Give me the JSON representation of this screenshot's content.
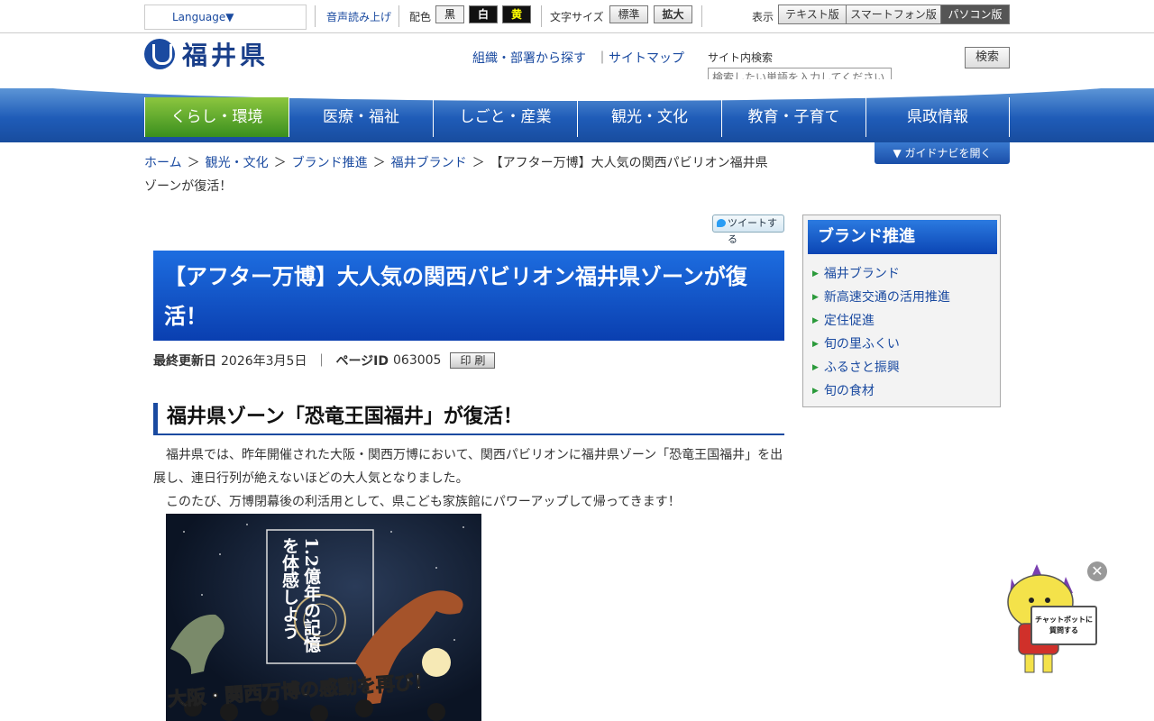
{
  "topbar": {
    "language": "Language▼",
    "read_aloud": "音声読み上げ",
    "color_label": "配色",
    "color_black": "黒",
    "color_white": "白",
    "color_yellow": "黄",
    "font_size_label": "文字サイズ",
    "font_standard": "標準",
    "font_large": "拡大",
    "display_label": "表示",
    "display_text": "テキスト版",
    "display_phone": "スマートフォン版",
    "display_pc": "パソコン版"
  },
  "header": {
    "logo_text": "福井県",
    "org_link": "組織・部署から探す",
    "link_separator": "｜",
    "sitemap_link": "サイトマップ",
    "search_label": "サイト内検索",
    "search_placeholder": "検索したい単語を入力してください",
    "search_button": "検索"
  },
  "nav": {
    "items": [
      {
        "label": "くらし・環境"
      },
      {
        "label": "医療・福祉"
      },
      {
        "label": "しごと・産業"
      },
      {
        "label": "観光・文化"
      },
      {
        "label": "教育・子育て"
      },
      {
        "label": "県政情報"
      }
    ],
    "guide_button": "▼ ガイドナビを開く"
  },
  "breadcrumb": {
    "items": [
      "ホーム",
      "観光・文化",
      "ブランド推進",
      "福井ブランド"
    ],
    "separator": "＞",
    "current": "【アフター万博】大人気の関西パビリオン福井県ゾーンが復活！"
  },
  "tweet_button": "ツイートする",
  "main": {
    "title": "【アフター万博】大人気の関西パビリオン福井県ゾーンが復活！",
    "updated_label": "最終更新日",
    "updated_value": "2026年3月5日",
    "meta_separator": "｜",
    "page_id_label": "ページID",
    "page_id_value": "063005",
    "print_button": "印 刷",
    "section_heading": "福井県ゾーン「恐竜王国福井」が復活！",
    "paragraph1": "福井県では、昨年開催された大阪・関西万博において、関西パビリオンに福井県ゾーン「恐竜王国福井」を出展し、連日行列が絶えないほどの大人気となりました。",
    "paragraph2": "このたび、万博閉幕後の利活用として、県こども家族館にパワーアップして帰ってきます！",
    "poster_text": "1.2億年の記憶を体感しよう",
    "poster_catch": "大阪・関西万博の感動を再び！"
  },
  "sidebar": {
    "title": "ブランド推進",
    "items": [
      {
        "label": "福井ブランド"
      },
      {
        "label": "新高速交通の活用推進"
      },
      {
        "label": "定住促進"
      },
      {
        "label": "旬の里ふくい"
      },
      {
        "label": "ふるさと振興"
      },
      {
        "label": "旬の食材"
      }
    ]
  },
  "chatbot": {
    "bubble_text": "チャットボットに質問する",
    "close_symbol": "✕"
  },
  "colors": {
    "brand_blue": "#1a4aa0",
    "nav_active_green": "#3a8f1e",
    "title_blue": "#0a3fb0"
  }
}
